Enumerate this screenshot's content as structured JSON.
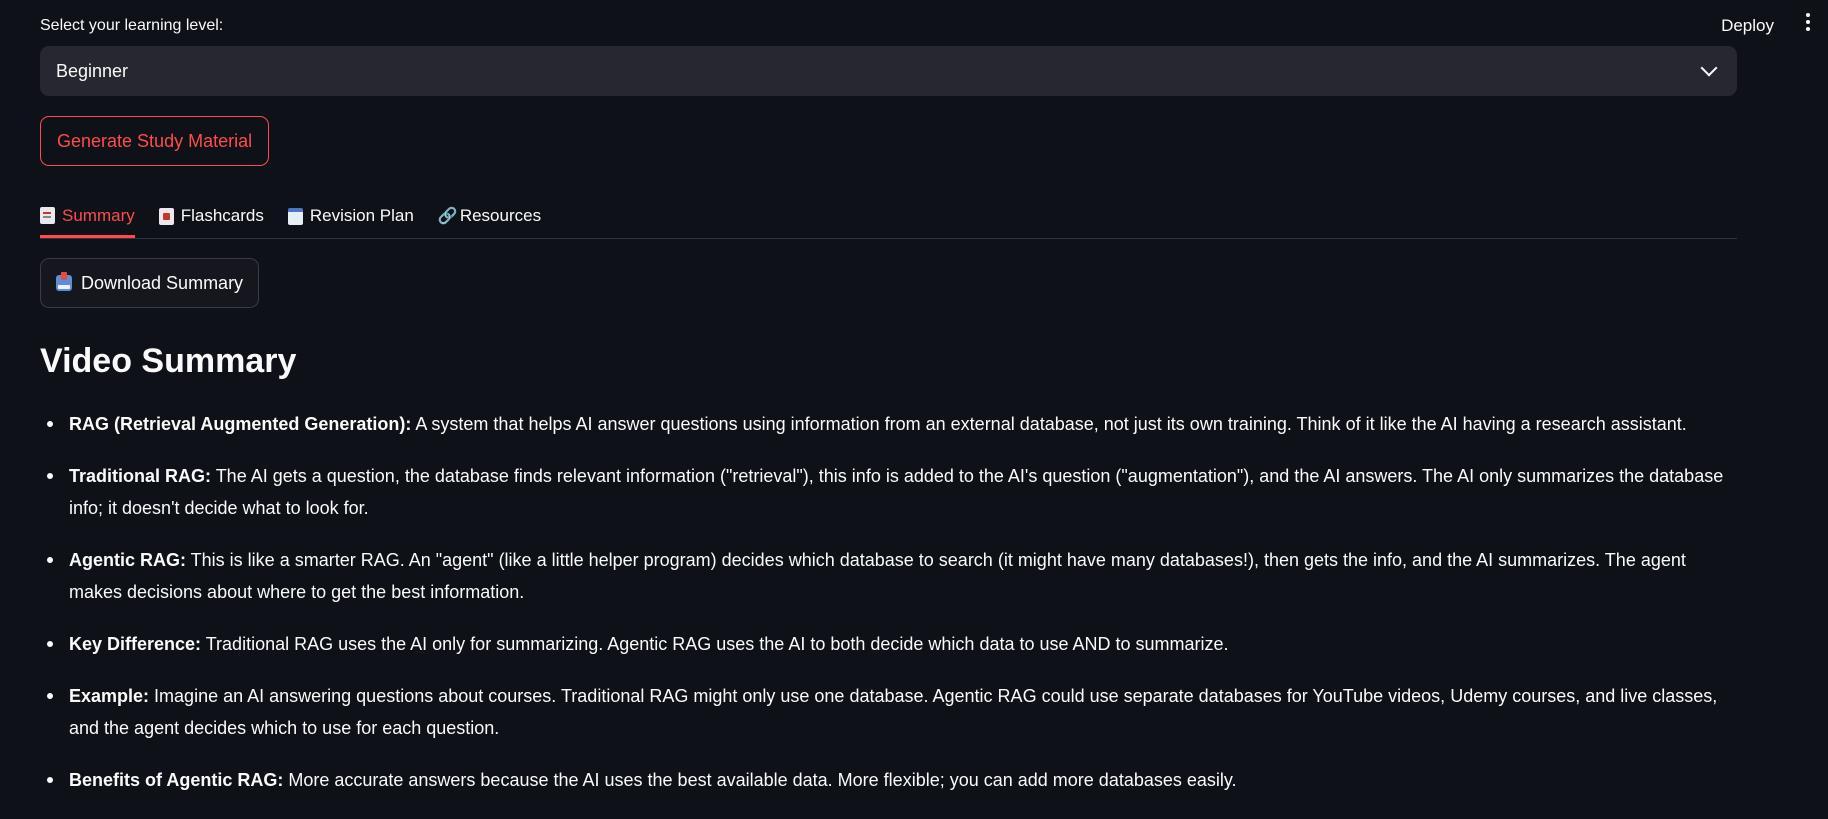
{
  "header": {
    "deploy_label": "Deploy",
    "menu_icon": "more-vertical-icon"
  },
  "level_select": {
    "label": "Select your learning level:",
    "value": "Beginner"
  },
  "generate_button": {
    "label": "Generate Study Material"
  },
  "tabs": [
    {
      "label": "Summary",
      "icon": "document-icon",
      "active": true
    },
    {
      "label": "Flashcards",
      "icon": "flashcard-icon",
      "active": false
    },
    {
      "label": "Revision Plan",
      "icon": "calendar-icon",
      "active": false
    },
    {
      "label": "Resources",
      "icon": "link-icon",
      "active": false
    }
  ],
  "download_button": {
    "label": "Download Summary",
    "icon": "inbox-tray-icon"
  },
  "summary": {
    "title": "Video Summary",
    "items": [
      {
        "term": "RAG (Retrieval Augmented Generation):",
        "text": " A system that helps AI answer questions using information from an external database, not just its own training. Think of it like the AI having a research assistant."
      },
      {
        "term": "Traditional RAG:",
        "text": " The AI gets a question, the database finds relevant information (\"retrieval\"), this info is added to the AI's question (\"augmentation\"), and the AI answers. The AI only summarizes the database info; it doesn't decide what to look for."
      },
      {
        "term": "Agentic RAG:",
        "text": " This is like a smarter RAG. An \"agent\" (like a little helper program) decides which database to search (it might have many databases!), then gets the info, and the AI summarizes. The agent makes decisions about where to get the best information."
      },
      {
        "term": "Key Difference:",
        "text": " Traditional RAG uses the AI only for summarizing. Agentic RAG uses the AI to both decide which data to use AND to summarize."
      },
      {
        "term": "Example:",
        "text": " Imagine an AI answering questions about courses. Traditional RAG might only use one database. Agentic RAG could use separate databases for YouTube videos, Udemy courses, and live classes, and the agent decides which to use for each question."
      },
      {
        "term": "Benefits of Agentic RAG:",
        "text": " More accurate answers because the AI uses the best available data. More flexible; you can add more databases easily."
      }
    ]
  },
  "colors": {
    "background": "#0e1117",
    "accent": "#ff4b4b",
    "input_bg": "#262730",
    "text": "#fafafa"
  }
}
